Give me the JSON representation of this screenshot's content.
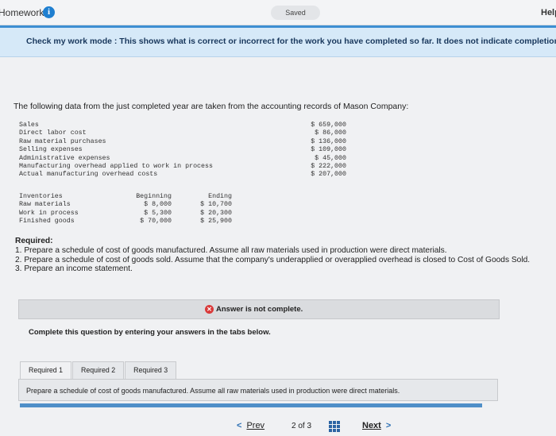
{
  "header": {
    "title": "Homework",
    "info_icon": "info-icon",
    "saved": "Saved",
    "help": "Help"
  },
  "banner": {
    "text": "Check my work mode : This shows what is correct or incorrect for the work you have completed so far. It does not indicate completion."
  },
  "question": {
    "intro": "The following data from the just completed year are taken from the accounting records of Mason Company:",
    "data_rows": [
      {
        "label": "Sales",
        "value": "$ 659,000"
      },
      {
        "label": "Direct labor cost",
        "value": "$ 86,000"
      },
      {
        "label": "Raw material purchases",
        "value": "$ 136,000"
      },
      {
        "label": "Selling expenses",
        "value": "$ 109,000"
      },
      {
        "label": "Administrative expenses",
        "value": "$ 45,000"
      },
      {
        "label": "Manufacturing overhead applied to work in process",
        "value": "$ 222,000"
      },
      {
        "label": "Actual manufacturing overhead costs",
        "value": "$ 207,000"
      }
    ],
    "inventories": {
      "headers": [
        "Inventories",
        "Beginning",
        "Ending"
      ],
      "rows": [
        [
          "Raw materials",
          "$ 8,000",
          "$ 10,700"
        ],
        [
          "Work in process",
          "$ 5,300",
          "$ 20,300"
        ],
        [
          "Finished goods",
          "$ 70,000",
          "$ 25,900"
        ]
      ]
    },
    "required_heading": "Required:",
    "required_items": [
      "1. Prepare a schedule of cost of goods manufactured. Assume all raw materials used in production were direct materials.",
      "2. Prepare a schedule of cost of goods sold. Assume that the company's underapplied or overapplied overhead is closed to Cost of Goods Sold.",
      "3. Prepare an income statement."
    ]
  },
  "answer_status": "Answer is not complete.",
  "instruction": "Complete this question by entering your answers in the tabs below.",
  "tabs": [
    "Required 1",
    "Required 2",
    "Required 3"
  ],
  "active_tab": "Required 1",
  "panel_text": "Prepare a schedule of cost of goods manufactured. Assume all raw materials used in production were direct materials.",
  "navigation": {
    "prev": "Prev",
    "page_current": "2",
    "page_of": "of",
    "page_total": "3",
    "next": "Next"
  }
}
